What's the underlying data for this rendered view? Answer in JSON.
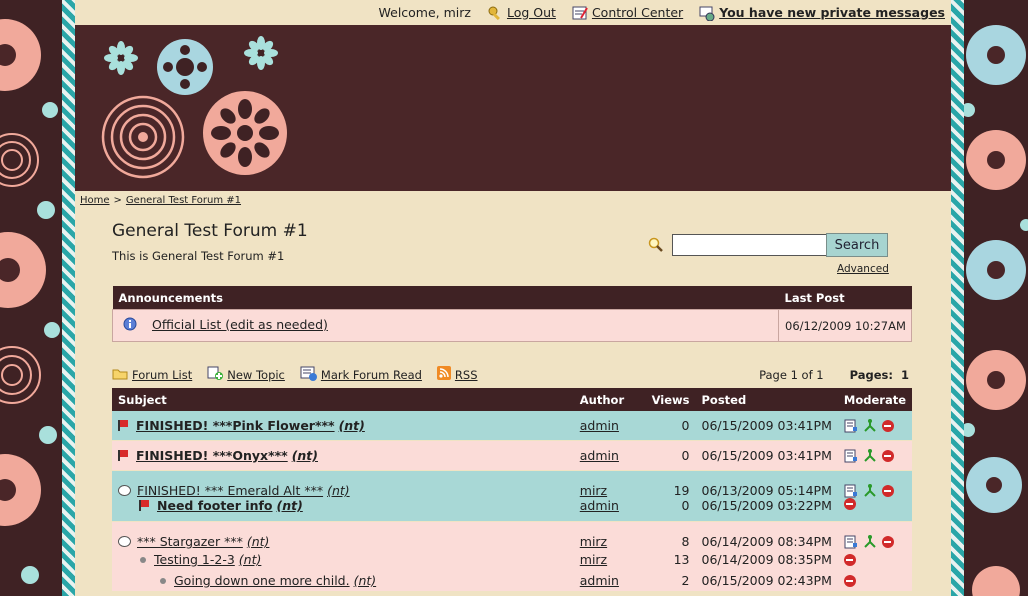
{
  "topbar": {
    "welcome": "Welcome, mirz",
    "logout": "Log Out",
    "control_center": "Control Center",
    "private_messages": "You have new private messages"
  },
  "breadcrumb": {
    "home": "Home",
    "sep": ">",
    "current": "General Test Forum #1"
  },
  "forum": {
    "title": "General Test Forum #1",
    "description": "This is General Test Forum #1"
  },
  "search": {
    "button": "Search",
    "advanced": "Advanced",
    "value": ""
  },
  "announcements": {
    "header": "Announcements",
    "last_post_header": "Last Post",
    "items": [
      {
        "title": "Official List (edit as needed)",
        "last_post": "06/12/2009 10:27AM"
      }
    ]
  },
  "toolbar": {
    "forum_list": "Forum List",
    "new_topic": "New Topic",
    "mark_read": "Mark Forum Read",
    "rss": "RSS",
    "page_info": "Page 1 of 1",
    "pages_label": "Pages:",
    "page_number": "1"
  },
  "topics": {
    "headers": {
      "subject": "Subject",
      "author": "Author",
      "views": "Views",
      "posted": "Posted",
      "moderate": "Moderate"
    },
    "rows": [
      {
        "subject": "FINISHED! ***Pink Flower***",
        "suffix": "(nt)",
        "author": "admin",
        "views": "0",
        "posted": "06/15/2009 03:41PM"
      },
      {
        "subject": "FINISHED! ***Onyx***",
        "suffix": "(nt)",
        "author": "admin",
        "views": "0",
        "posted": "06/15/2009 03:41PM"
      },
      {
        "subject": "FINISHED! *** Emerald Alt ***",
        "suffix": "(nt)",
        "author": "mirz",
        "views": "19",
        "posted": "06/13/2009 05:14PM"
      },
      {
        "subject": "Need footer info",
        "suffix": "(nt)",
        "author": "admin",
        "views": "0",
        "posted": "06/15/2009 03:22PM"
      },
      {
        "subject": "*** Stargazer ***",
        "suffix": "(nt)",
        "author": "mirz",
        "views": "8",
        "posted": "06/14/2009 08:34PM"
      },
      {
        "subject": "Testing 1-2-3",
        "suffix": "(nt)",
        "author": "mirz",
        "views": "13",
        "posted": "06/14/2009 08:35PM"
      },
      {
        "subject": "Going down one more child.",
        "suffix": "(nt)",
        "author": "admin",
        "views": "2",
        "posted": "06/15/2009 02:43PM"
      }
    ]
  },
  "colors": {
    "brown": "#3f2224",
    "teal": "#a8d8d6",
    "pink": "#fbdcd8",
    "cream": "#f0e3c4"
  }
}
